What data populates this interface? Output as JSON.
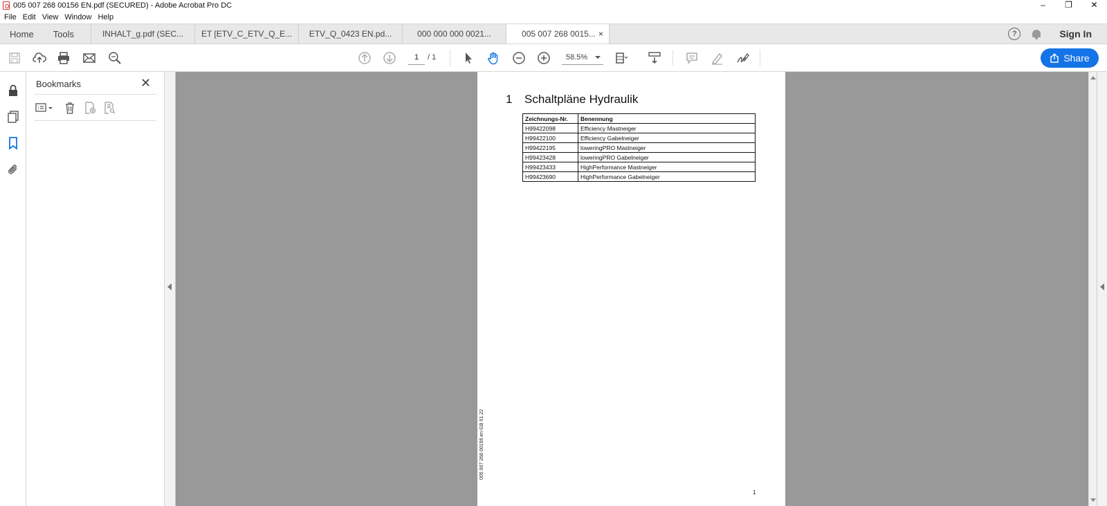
{
  "window": {
    "title": "005 007 268 00156 EN.pdf (SECURED) - Adobe Acrobat Pro DC",
    "controls": {
      "minimize": "–",
      "restore": "❐",
      "close": "✕"
    }
  },
  "menu": [
    "File",
    "Edit",
    "View",
    "Window",
    "Help"
  ],
  "tabs": {
    "home": "Home",
    "tools": "Tools",
    "documents": [
      "INHALT_g.pdf (SEC...",
      "ET [ETV_C_ETV_Q_E...",
      "ETV_Q_0423 EN.pd...",
      "000 000 000 0021...",
      "005 007 268 0015..."
    ],
    "active_index": 4,
    "close_glyph": "×",
    "help_glyph": "?",
    "sign_in": "Sign In"
  },
  "toolbar": {
    "page_current": "1",
    "page_total": "/ 1",
    "zoom": "58.5%",
    "share_label": "Share"
  },
  "bookmarks": {
    "title": "Bookmarks",
    "close_glyph": "✕"
  },
  "document": {
    "section_number": "1",
    "section_title": "Schaltpläne Hydraulik",
    "table": {
      "headers": [
        "Zeichnungs-Nr.",
        "Benennung"
      ],
      "rows": [
        [
          "H99422098",
          "Efficiency Mastneiger"
        ],
        [
          "H99422100",
          "Efficiency Gabelneiger"
        ],
        [
          "H99422195",
          "loweringPRO Mastneiger"
        ],
        [
          "H99423428",
          "loweringPRO Gabelneiger"
        ],
        [
          "H99423433",
          "HighPerformance Mastneiger"
        ],
        [
          "H99423690",
          "HighPerformance Gabelneiger"
        ]
      ]
    },
    "doc_id": "005 007 268 00156 en-GB 01.22",
    "page_number": "1"
  },
  "colors": {
    "accent": "#1473e6",
    "viewer_bg": "#999999",
    "bookmark_active": "#1473e6"
  }
}
